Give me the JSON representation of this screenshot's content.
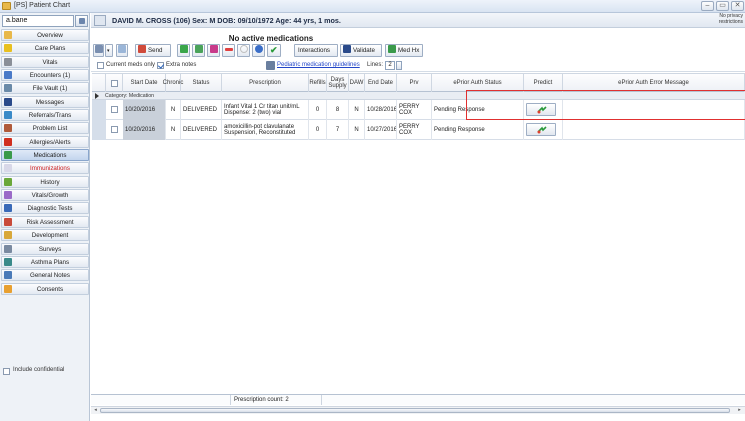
{
  "window": {
    "title": "[PS] Patient Chart",
    "buttons": [
      "–",
      "▭",
      "✕"
    ]
  },
  "patient": {
    "selector_value": "a.bane",
    "demographics": "DAVID M. CROSS (106) Sex: M DOB: 09/10/1972 Age: 44 yrs, 1 mos.",
    "privacy_note": "No privacy restrictions"
  },
  "sidebar": {
    "items": [
      {
        "label": "Overview",
        "icon": "folder-icon"
      },
      {
        "label": "Care Plans",
        "icon": "warning-icon"
      },
      {
        "label": "Vitals",
        "icon": "vitals-icon"
      },
      {
        "label": "Encounters (1)",
        "icon": "encounter-icon"
      },
      {
        "label": "File Vault (1)",
        "icon": "file-vault-icon"
      },
      {
        "label": "Messages",
        "icon": "messages-icon"
      },
      {
        "label": "Referrals/Trans",
        "icon": "referral-icon"
      },
      {
        "label": "Problem List",
        "icon": "problem-list-icon"
      },
      {
        "label": "Allergies/Alerts",
        "icon": "allergy-icon"
      },
      {
        "label": "Medications",
        "icon": "medications-icon"
      },
      {
        "label": "Immunizations",
        "icon": "immunization-icon"
      },
      {
        "label": "History",
        "icon": "history-icon"
      },
      {
        "label": "Vitals/Growth",
        "icon": "growth-icon"
      },
      {
        "label": "Diagnostic Tests",
        "icon": "diagnostic-icon"
      },
      {
        "label": "Risk Assessment",
        "icon": "risk-icon"
      },
      {
        "label": "Development",
        "icon": "development-icon"
      },
      {
        "label": "Surveys",
        "icon": "survey-icon"
      },
      {
        "label": "Asthma Plans",
        "icon": "asthma-icon"
      },
      {
        "label": "General Notes",
        "icon": "notes-icon"
      },
      {
        "label": "Consents",
        "icon": "consent-icon"
      }
    ],
    "active_item": "Medications",
    "include_confidential": "Include confidential"
  },
  "toolbar": {
    "send": "Send",
    "interactions": "Interactions",
    "validate": "Validate",
    "medhx": "Med Hx"
  },
  "banner": "No active medications",
  "filters": {
    "current_meds_only": "Current meds only",
    "current_meds_checked": false,
    "extra_notes": "Extra notes",
    "extra_notes_checked": true,
    "guidelines_link": "Pediatric medication guidelines",
    "lines_label": "Lines:",
    "lines_value": "2"
  },
  "table": {
    "columns": [
      "Start Date",
      "Chronic",
      "Status",
      "Prescription",
      "Refills",
      "Days Supply",
      "DAW",
      "End Date",
      "Prv",
      "ePrior Auth Status",
      "Predict",
      "ePrior Auth Error Message"
    ],
    "group_label": "Category: Medication",
    "rows": [
      {
        "start_date": "10/20/2016",
        "chronic": "N",
        "status": "DELIVERED",
        "prescription": "Infant Vital 1 Cr titan unit/mL Dispense: 2 (two) vial",
        "refills": "0",
        "days_supply": "8",
        "daw": "N",
        "end_date": "10/28/2016",
        "prv": "PERRY COX",
        "pa_status": "Pending Response",
        "pa_error": ""
      },
      {
        "start_date": "10/20/2016",
        "chronic": "N",
        "status": "DELIVERED",
        "prescription": "amoxicillin-pot clavulanate Suspension, Reconstituted",
        "refills": "0",
        "days_supply": "7",
        "daw": "N",
        "end_date": "10/27/2016",
        "prv": "PERRY COX",
        "pa_status": "Pending Response",
        "pa_error": ""
      }
    ]
  },
  "status": {
    "prescription_count": "Prescription count: 2"
  },
  "colors": {
    "highlight_box": "#e03030",
    "link": "#2346c8",
    "immunizations_label": "#d02020"
  }
}
